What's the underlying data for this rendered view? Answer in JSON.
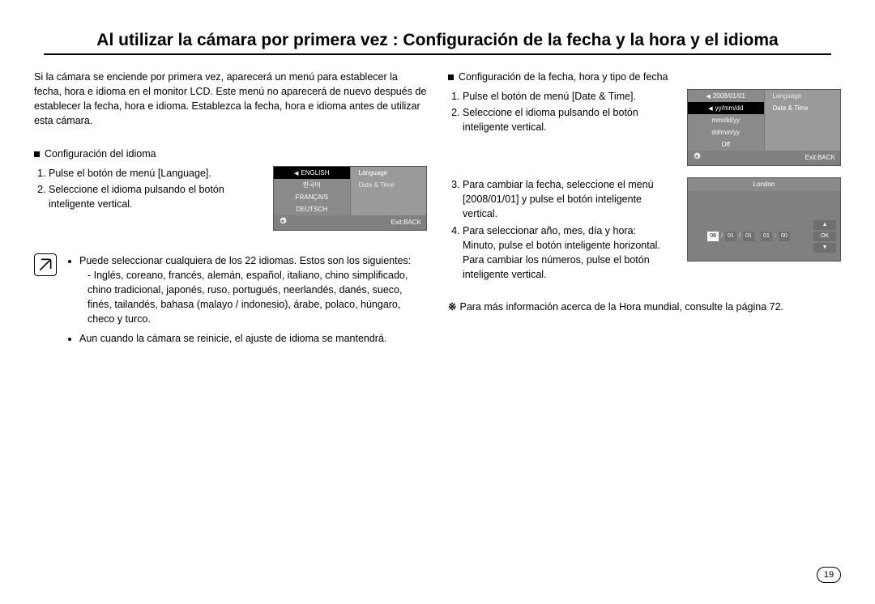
{
  "title": "Al utilizar la cámara por primera vez : Configuración de la fecha y la hora y el idioma",
  "left": {
    "intro": "Si la cámara se enciende por primera vez, aparecerá un menú para establecer la fecha, hora e idioma en el monitor LCD. Este menú no aparecerá de nuevo después de establecer la fecha, hora e idioma. Establezca la fecha, hora e idioma antes de utilizar esta cámara.",
    "section_title": "Configuración del idioma",
    "step1": "Pulse el botón de menú [Language].",
    "step2": "Seleccione el idioma pulsando el botón inteligente vertical.",
    "lcd": {
      "left_items": [
        "ENGLISH",
        "한국어",
        "FRANÇAIS",
        "DEUTSCH"
      ],
      "right_items": [
        "Language",
        "Date & Time"
      ],
      "exit": "Exit:BACK"
    },
    "note1_lead": "Puede seleccionar cualquiera de los 22 idiomas. Estos son los siguientes:",
    "note1_langs": "- Inglés, coreano, francés, alemán, español, italiano, chino simplificado, chino tradicional, japonés, ruso, portugués, neerlandés, danés, sueco, finés, tailandés, bahasa (malayo / indonesio), árabe, polaco, húngaro, checo y turco.",
    "note2": "Aun cuando la cámara se reinicie, el ajuste de idioma se mantendrá."
  },
  "right": {
    "section_title": "Configuración de la fecha, hora y tipo de fecha",
    "step1": "Pulse el botón de menú [Date & Time].",
    "step2": "Seleccione el idioma pulsando el botón inteligente vertical.",
    "lcd_top": {
      "left_items": [
        "2008/01/01",
        "yy/mm/dd",
        "mm/dd/yy",
        "dd/mm/yy",
        "Off"
      ],
      "right_items": [
        "Language",
        "Date & Time"
      ],
      "exit": "Exit:BACK"
    },
    "step3": "Para cambiar la fecha, seleccione el menú [2008/01/01] y pulse el botón inteligente vertical.",
    "step4a": "Para seleccionar año, mes, día y hora:",
    "step4b": "Minuto, pulse el botón inteligente horizontal.",
    "step4c": "Para cambiar los números, pulse el botón inteligente vertical.",
    "lcd_bottom": {
      "city": "London",
      "date": [
        "08",
        "01",
        "01",
        "01",
        "00"
      ],
      "ok": "OK"
    },
    "footnote": "Para más información acerca de la Hora mundial, consulte la página 72."
  },
  "page_number": "19"
}
